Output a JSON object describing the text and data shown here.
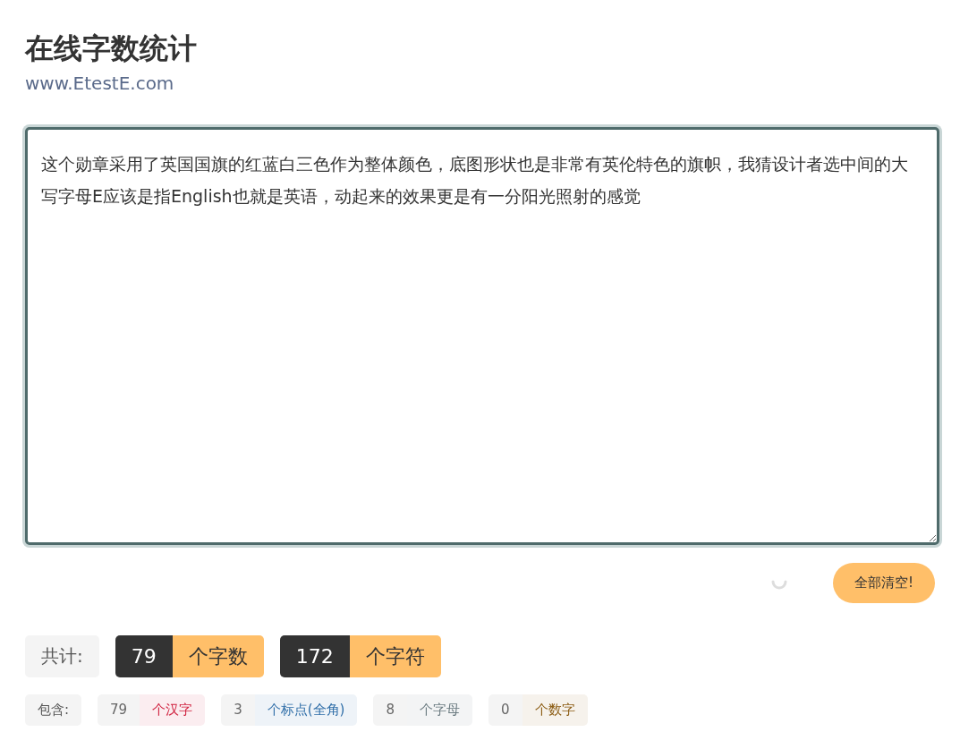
{
  "header": {
    "title": "在线字数统计",
    "subtitle": "www.EtestE.com"
  },
  "editor": {
    "value": "这个勋章采用了英国国旗的红蓝白三色作为整体颜色，底图形状也是非常有英伦特色的旗帜，我猜设计者选中间的大写字母E应该是指English也就是英语，动起来的效果更是有一分阳光照射的感觉"
  },
  "clear_button": "全部清空!",
  "totals": {
    "label": "共计:",
    "items": [
      {
        "count": "79",
        "unit": "个字数"
      },
      {
        "count": "172",
        "unit": "个字符"
      }
    ]
  },
  "details": {
    "label": "包含:",
    "items": [
      {
        "count": "79",
        "unit": "个汉字",
        "color": "#d0213f"
      },
      {
        "count": "3",
        "unit": "个标点(全角)",
        "color": "#2f6ea8"
      },
      {
        "count": "8",
        "unit": "个字母",
        "color": "#6a7a80"
      },
      {
        "count": "0",
        "unit": "个数字",
        "color": "#8a5a10"
      }
    ]
  }
}
